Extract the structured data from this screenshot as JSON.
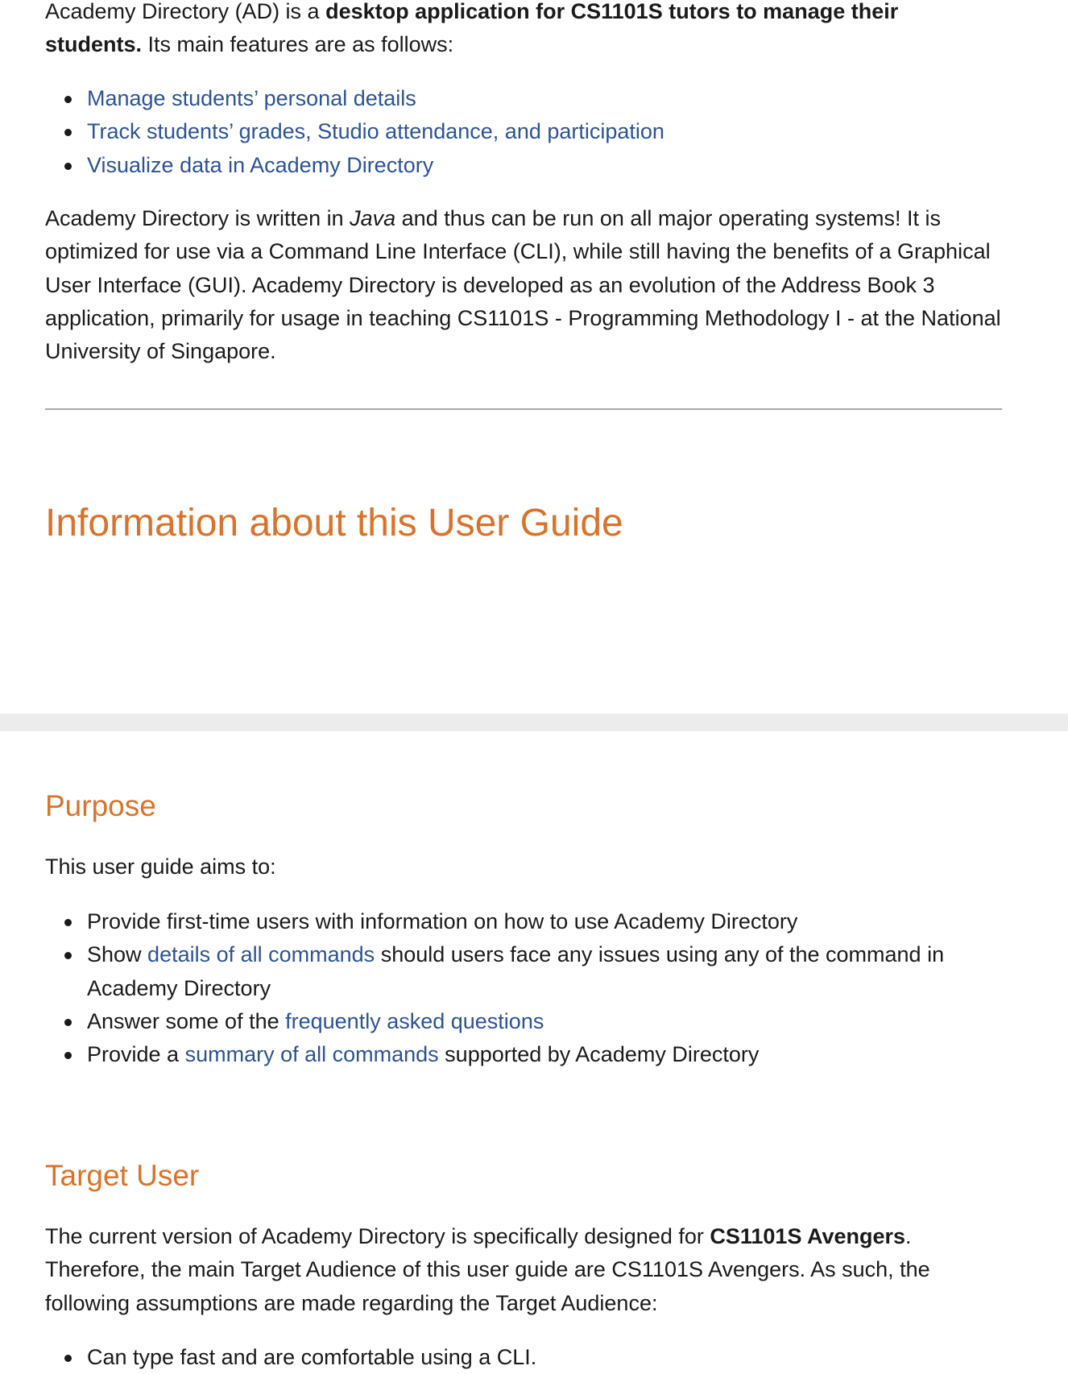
{
  "intro": {
    "p1_lead": "Academy Directory (AD) is a ",
    "p1_bold": "desktop application for CS1101S tutors to manage their students.",
    "p1_tail": " Its main features are as follows:",
    "features": [
      "Manage students’ personal details",
      "Track students’ grades, Studio attendance, and participation",
      "Visualize data in Academy Directory"
    ],
    "p2_lead": "Academy Directory is written in ",
    "p2_italic": "Java",
    "p2_tail": " and thus can be run on all major operating systems! It is optimized for use via a Command Line Interface (CLI), while still having the benefits of a Graphical User Interface (GUI). Academy Directory is developed as an evolution of the Address Book 3 application, primarily for usage in teaching CS1101S - Programming Methodology I - at the National University of Singapore."
  },
  "section_title": "Information about this User Guide",
  "purpose": {
    "heading": "Purpose",
    "intro": "This user guide aims to:",
    "item1": "Provide first-time users with information on how to use Academy Directory",
    "item2_lead": "Show ",
    "item2_link": "details of all commands",
    "item2_tail": " should users face any issues using any of the command in Academy Directory",
    "item3_lead": "Answer some of the ",
    "item3_link": "frequently asked questions",
    "item4_lead": "Provide a ",
    "item4_link": "summary of all commands",
    "item4_tail": " supported by Academy Directory"
  },
  "target_user": {
    "heading": "Target User",
    "p_lead": "The current version of Academy Directory is specifically designed for ",
    "p_bold": "CS1101S Avengers",
    "p_tail": ". Therefore, the main Target Audience of this user guide are CS1101S Avengers. As such, the following assumptions are made regarding the Target Audience:",
    "assumptions": [
      "Can type fast and are comfortable using a CLI."
    ]
  },
  "colors": {
    "heading": "#d9732b",
    "link": "#2c5396",
    "text": "#1a1a1a",
    "band": "#ececec"
  }
}
